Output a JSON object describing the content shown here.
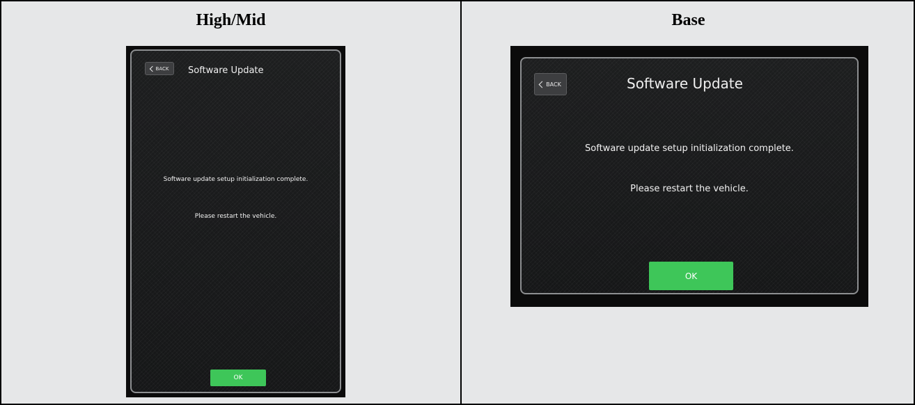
{
  "columns": {
    "left_heading": "High/Mid",
    "right_heading": "Base"
  },
  "high_mid_screen": {
    "back_label": "BACK",
    "title": "Software Update",
    "message_line1": "Software update setup initialization complete.",
    "message_line2": "Please restart the vehicle.",
    "ok_label": "OK"
  },
  "base_screen": {
    "back_label": "BACK",
    "title": "Software Update",
    "message_line1": "Software update setup initialization complete.",
    "message_line2": "Please restart the vehicle.",
    "ok_label": "OK"
  },
  "colors": {
    "ok_button": "#3ec659",
    "screen_background": "#1b1c1d",
    "table_background": "#e6e7e8"
  },
  "icons": {
    "back": "chevron-left-icon"
  }
}
